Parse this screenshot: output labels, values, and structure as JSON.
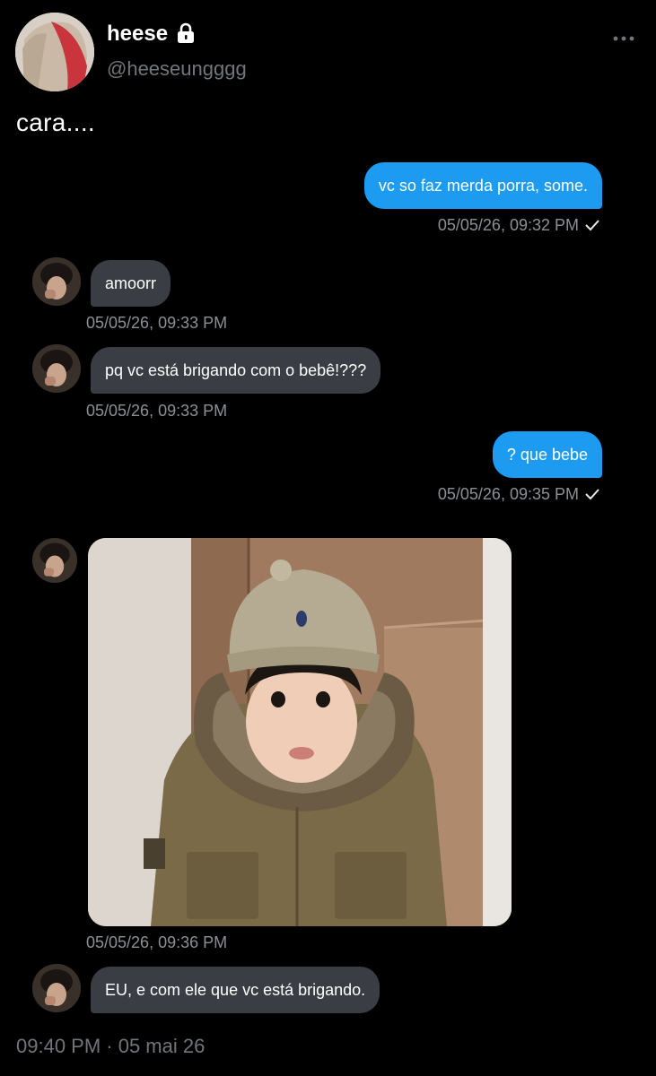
{
  "profile": {
    "name": "heese",
    "handle": "@heeseungggg",
    "avatar_icon": "profile-avatar",
    "verified_icon": "lock-icon"
  },
  "tweet": {
    "text": "cara....",
    "footer": "09:40 PM · 05 mai 26"
  },
  "messages": [
    {
      "direction": "outgoing",
      "text": "vc so faz merda porra, some.",
      "time": "05/05/26, 09:32 PM"
    },
    {
      "direction": "incoming",
      "text": "amoorr",
      "time": "05/05/26, 09:33 PM"
    },
    {
      "direction": "incoming",
      "text": "pq vc está brigando com o bebê!???",
      "time": "05/05/26, 09:33 PM"
    },
    {
      "direction": "outgoing",
      "text": "? que bebe",
      "time": "05/05/26, 09:35 PM"
    },
    {
      "direction": "incoming",
      "type": "image",
      "time": "05/05/26, 09:36 PM"
    },
    {
      "direction": "incoming",
      "text": "EU, e com ele que vc está brigando."
    }
  ],
  "colors": {
    "background": "#000000",
    "outgoing_bubble": "#1d9bf0",
    "incoming_bubble": "#3a3e44",
    "secondary_text": "#71767b"
  }
}
